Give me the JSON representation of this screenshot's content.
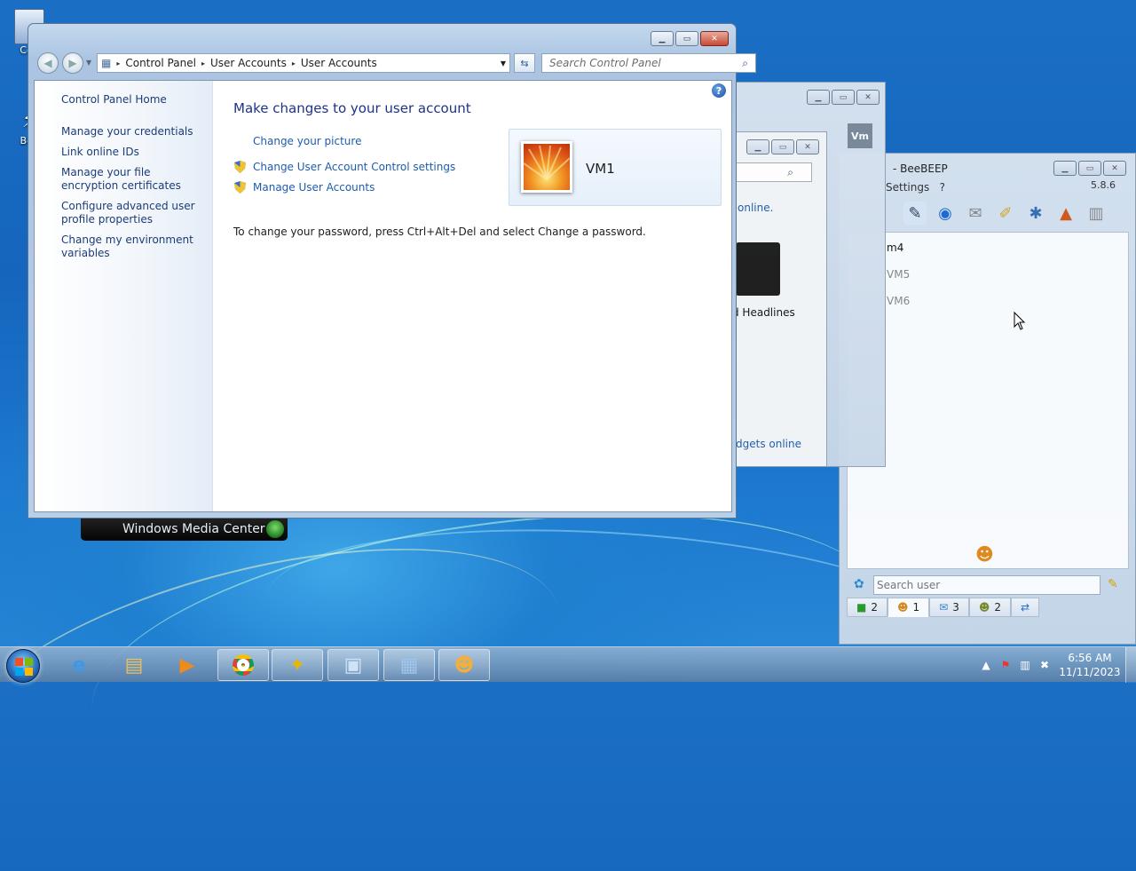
{
  "desktop": {
    "icons": [
      {
        "label": "Con"
      },
      {
        "label": "Bee"
      }
    ]
  },
  "control_panel": {
    "breadcrumb": [
      "Control Panel",
      "User Accounts",
      "User Accounts"
    ],
    "search_placeholder": "Search Control Panel",
    "left_links": [
      "Control Panel Home",
      "Manage your credentials",
      "Link online IDs",
      "Manage your file encryption certificates",
      "Configure advanced user profile properties",
      "Change my environment variables"
    ],
    "heading": "Make changes to your user account",
    "links": {
      "change_picture": "Change your picture",
      "uac": "Change User Account Control settings",
      "manage": "Manage User Accounts"
    },
    "password_note": "To change your password, press Ctrl+Alt+Del and select Change a password.",
    "account_name": "VM1",
    "help_label": "?"
  },
  "gadgets": {
    "online": "online.",
    "headlines": "d Headlines",
    "gadgets_online": "dgets online",
    "badge": "Vm"
  },
  "beebeep": {
    "title": "- BeeBEEP",
    "menu_settings": "Settings",
    "menu_help": "?",
    "version": "5.8.6",
    "users": [
      "m4",
      "VM5",
      "VM6"
    ],
    "search_placeholder": "Search user",
    "tabs": [
      {
        "icon": "chat-icon",
        "count": "2"
      },
      {
        "icon": "users-icon",
        "count": "1"
      },
      {
        "icon": "messages-icon",
        "count": "3"
      },
      {
        "icon": "groups-icon",
        "count": "2"
      },
      {
        "icon": "share-icon",
        "count": ""
      }
    ]
  },
  "media_center": {
    "label": "Windows Media Center"
  },
  "taskbar": {
    "time": "6:56 AM",
    "date": "11/11/2023"
  }
}
